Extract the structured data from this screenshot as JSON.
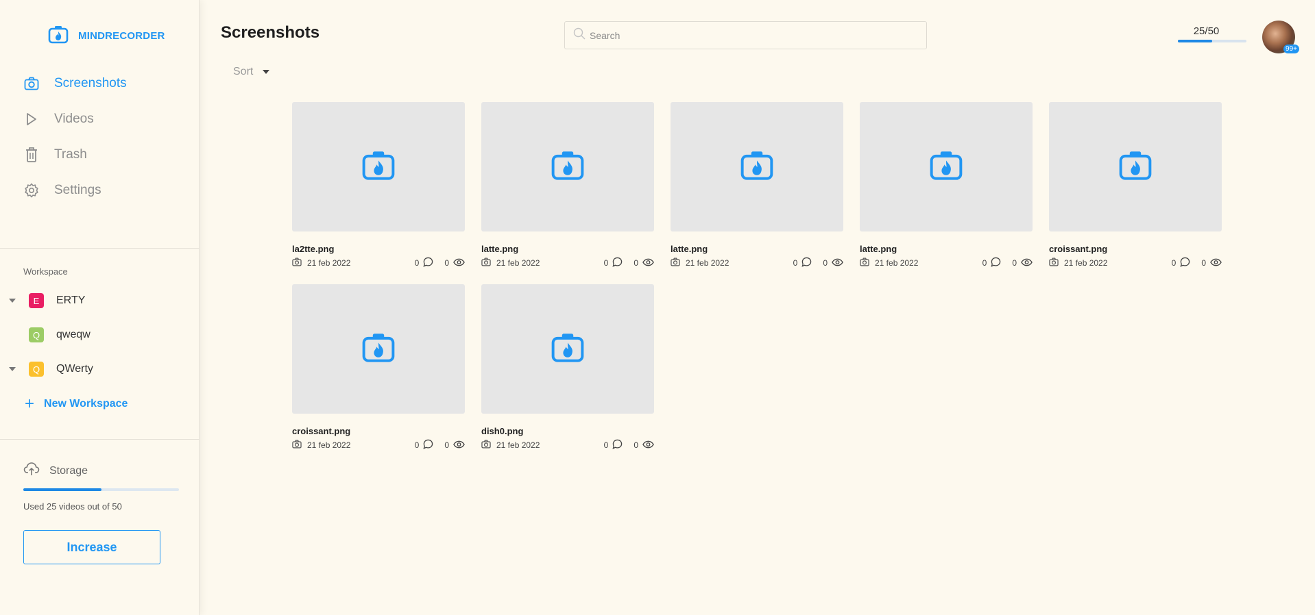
{
  "brand": {
    "name": "MINDRECORDER"
  },
  "nav": [
    {
      "label": "Screenshots",
      "icon": "camera-icon",
      "active": true
    },
    {
      "label": "Videos",
      "icon": "play-icon",
      "active": false
    },
    {
      "label": "Trash",
      "icon": "trash-icon",
      "active": false
    },
    {
      "label": "Settings",
      "icon": "gear-icon",
      "active": false
    }
  ],
  "workspace": {
    "title": "Workspace",
    "items": [
      {
        "letter": "E",
        "label": "ERTY",
        "color": "#e91e63",
        "expandable": true
      },
      {
        "letter": "Q",
        "label": "qweqw",
        "color": "#9ccc65",
        "expandable": false
      },
      {
        "letter": "Q",
        "label": "QWerty",
        "color": "#fbc02d",
        "expandable": true
      }
    ],
    "new_label": "New Workspace"
  },
  "storage": {
    "label": "Storage",
    "used_fraction": 0.5,
    "text": "Used 25 videos out of 50",
    "button_label": "Increase"
  },
  "header": {
    "title": "Screenshots",
    "search_placeholder": "Search",
    "quota_text": "25/50",
    "quota_fraction": 0.5,
    "notification_badge": "99+"
  },
  "sort": {
    "label": "Sort"
  },
  "files": [
    {
      "name": "la2tte.png",
      "date": "21 feb 2022",
      "comments": "0",
      "views": "0"
    },
    {
      "name": "latte.png",
      "date": "21 feb 2022",
      "comments": "0",
      "views": "0"
    },
    {
      "name": "latte.png",
      "date": "21 feb 2022",
      "comments": "0",
      "views": "0"
    },
    {
      "name": "latte.png",
      "date": "21 feb 2022",
      "comments": "0",
      "views": "0"
    },
    {
      "name": "croissant.png",
      "date": "21 feb 2022",
      "comments": "0",
      "views": "0"
    },
    {
      "name": "croissant.png",
      "date": "21 feb 2022",
      "comments": "0",
      "views": "0"
    },
    {
      "name": "dish0.png",
      "date": "21 feb 2022",
      "comments": "0",
      "views": "0"
    }
  ],
  "colors": {
    "accent": "#2196f3",
    "background": "#fdf9ee",
    "thumb": "#e6e6e6"
  }
}
